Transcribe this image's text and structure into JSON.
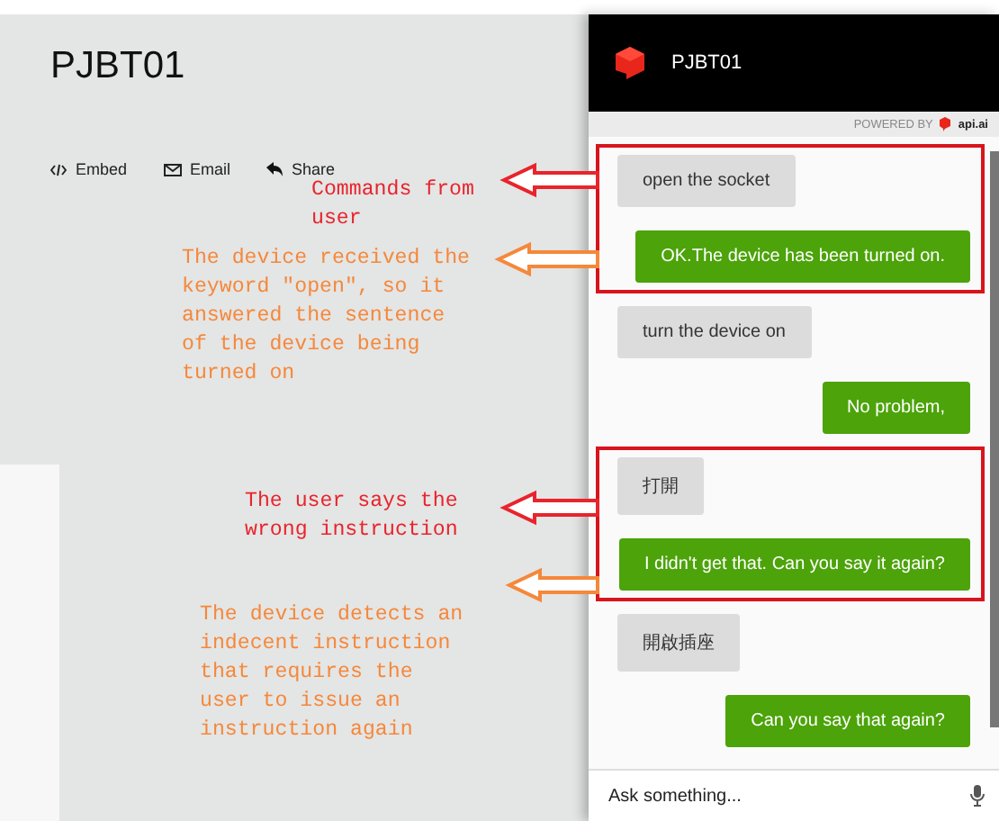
{
  "page": {
    "title": "PJBT01",
    "actions": [
      {
        "kind": "embed",
        "label": "Embed"
      },
      {
        "kind": "email",
        "label": "Email"
      },
      {
        "kind": "share",
        "label": "Share"
      }
    ]
  },
  "chat": {
    "title": "PJBT01",
    "powered_by": "POWERED BY",
    "brand": "api.ai",
    "messages": [
      {
        "kind": "user",
        "text": "open the socket",
        "highlighted": true
      },
      {
        "kind": "agent",
        "text": "OK.The device has been turned on.",
        "highlighted": true
      },
      {
        "kind": "user",
        "text": "turn the device on",
        "highlighted": false
      },
      {
        "kind": "agent",
        "text": "No problem,",
        "highlighted": false
      },
      {
        "kind": "user",
        "text": "打開",
        "highlighted": true
      },
      {
        "kind": "agent",
        "text": "I didn't get that. Can you say it again?",
        "highlighted": true
      },
      {
        "kind": "user",
        "text": "開啟插座",
        "highlighted": false
      },
      {
        "kind": "agent",
        "text": "Can you say that again?",
        "highlighted": false
      }
    ],
    "input": {
      "placeholder": "Ask something..."
    }
  },
  "annotations": [
    {
      "text": "Commands from user",
      "color": "#e8242c"
    },
    {
      "text": "The device received the keyword \"open\", so it answered the sentence of the device being turned on",
      "color": "#f5883a"
    },
    {
      "text": "The user says the wrong instruction",
      "color": "#e8242c"
    },
    {
      "text": "The device detects an indecent instruction that requires the user to issue an instruction again",
      "color": "#f5883a"
    }
  ]
}
